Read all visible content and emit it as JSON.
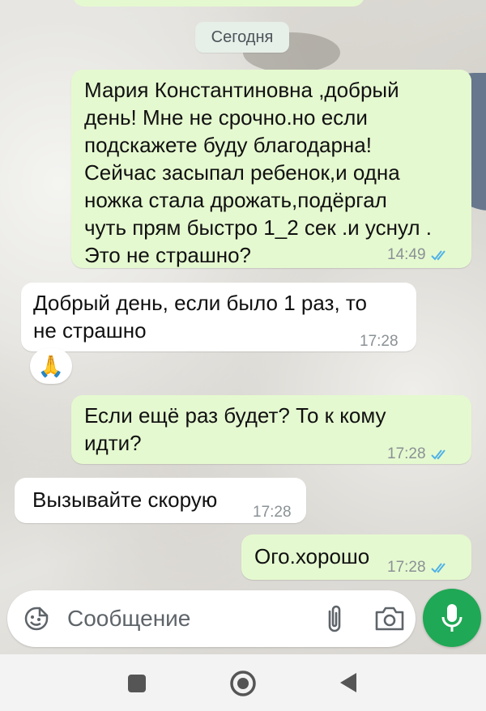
{
  "date_chip": "Сегодня",
  "messages": [
    {
      "direction": "outgoing",
      "text": "Мария Константиновна ,добрый\nдень! Мне не срочно.но если\nподскажете буду благодарна!\nСейчас засыпал ребенок,и одна\nножка стала дрожать,подёргал\nчуть прям быстро 1_2 сек .и уснул .\nЭто не страшно?",
      "time": "14:49",
      "status": "read"
    },
    {
      "direction": "incoming",
      "text": "Добрый день, если было 1 раз, то\nне страшно",
      "time": "17:28",
      "reaction": "🙏"
    },
    {
      "direction": "outgoing",
      "text": "Если ещё раз будет? То к кому\nидти?",
      "time": "17:28",
      "status": "read"
    },
    {
      "direction": "incoming",
      "text": "Вызывайте скорую",
      "time": "17:28"
    },
    {
      "direction": "outgoing",
      "text": "Ого.хорошо",
      "time": "17:28",
      "status": "read"
    }
  ],
  "composer": {
    "placeholder": "Сообщение"
  },
  "icons": {
    "emoji": "emoji-icon",
    "attach": "paperclip-icon",
    "camera": "camera-icon",
    "mic": "microphone-icon",
    "read_receipt": "double-check-icon"
  },
  "colors": {
    "outgoing_bubble": "#e5f9d0",
    "incoming_bubble": "#ffffff",
    "accent_green": "#1fa855",
    "read_tick": "#4fb2e6"
  }
}
